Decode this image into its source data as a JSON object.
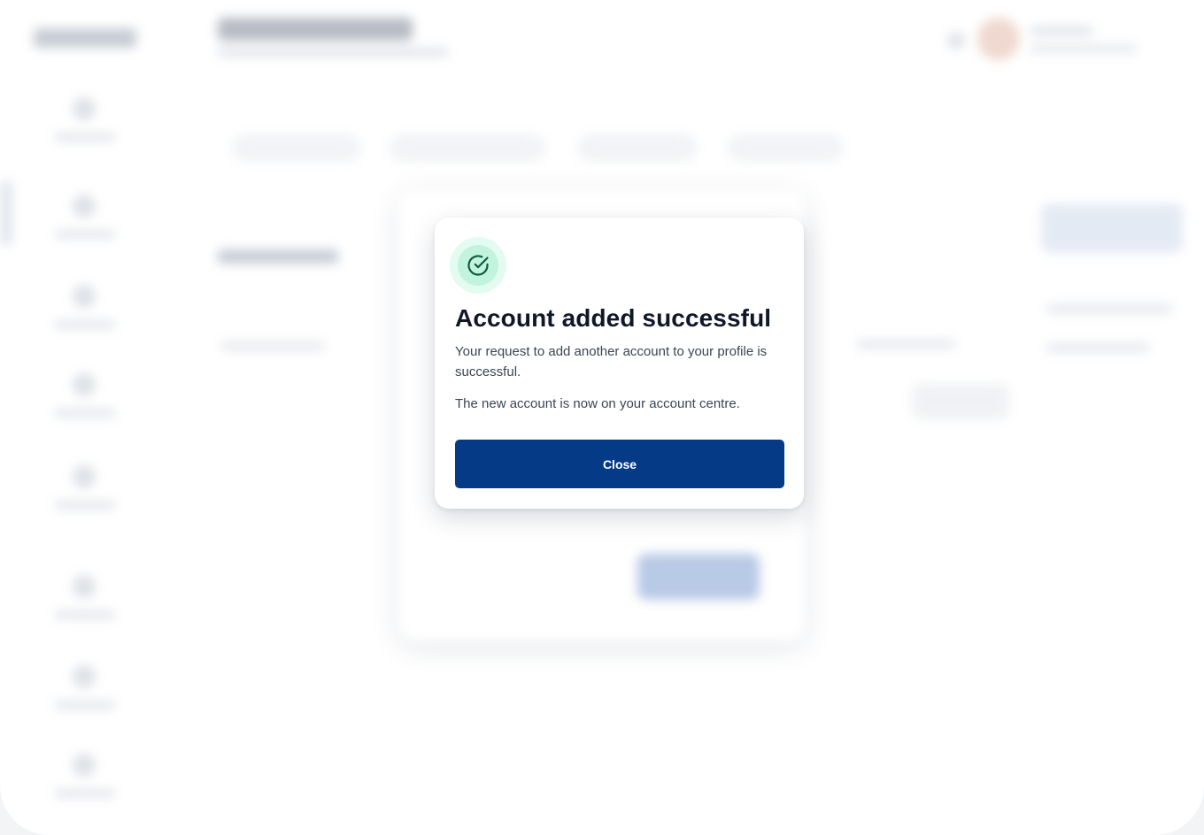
{
  "modal": {
    "icon": "check-circle-icon",
    "title": "Account added successful",
    "message": "Your request to add another account to your profile is successful.",
    "detail": "The new account is now on your account centre.",
    "close_label": "Close"
  },
  "colors": {
    "primary": "#043a86",
    "success_ring": "#c2f3de",
    "success_halo": "#e3fbf1",
    "success_icon": "#0d5a43",
    "title": "#0f1729",
    "body_text": "#3b4556"
  }
}
